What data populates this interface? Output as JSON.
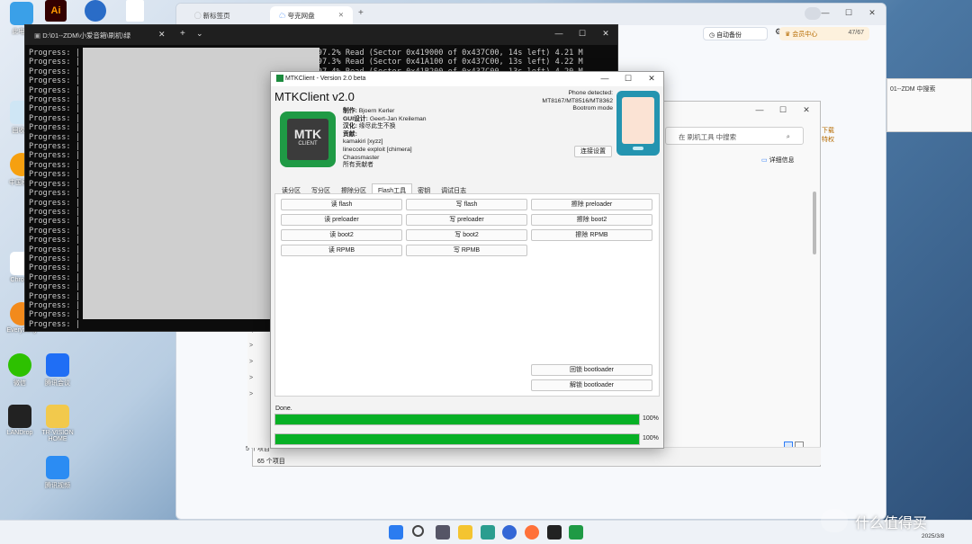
{
  "desktop": {
    "icons": [
      {
        "label": "此电脑"
      },
      {
        "label": "回收站"
      },
      {
        "label": "中国移动"
      },
      {
        "label": "Chrome"
      },
      {
        "label": "Everything"
      },
      {
        "label": "微信"
      },
      {
        "label": "腾讯会议"
      },
      {
        "label": "LANDrop"
      },
      {
        "label": "TR-VISION HOME"
      },
      {
        "label": "腾讯视频"
      }
    ]
  },
  "browser": {
    "tabs": [
      {
        "label": "新标签页"
      },
      {
        "label": "夸克网盘"
      }
    ],
    "new_tab": "+",
    "auto_backup": "自动备份",
    "vip_label": "会员中心",
    "storage": "47/67",
    "search_placeholder": "01--ZDM 中搜索",
    "download_label": "下载特权",
    "details_label": "详细信息"
  },
  "explorer": {
    "search_placeholder": "在 刷机工具 中搜索",
    "item_count": "5 个项目",
    "item_count_back": "65 个项目"
  },
  "terminal": {
    "title": "D:\\01--ZDM\\小爱音箱\\刷机\\绿",
    "lines": [
      "Progress: |                                                 | 97.2% Read (Sector 0x419000 of 0x437C00, 14s left) 4.21 M",
      "Progress: |                                                 | 97.3% Read (Sector 0x41A100 of 0x437C00, 13s left) 4.22 M",
      "Progress: |                                                 | 97.4% Read (Sector 0x41B200 of 0x437C00, 13s left) 4.20 M",
      "Progress: |",
      "Progress: |",
      "Progress: |",
      "Progress: |",
      "Progress: |",
      "Progress: |",
      "Progress: |",
      "Progress: |",
      "Progress: |",
      "Progress: |",
      "Progress: |",
      "Progress: |",
      "Progress: |",
      "Progress: |",
      "Progress: |",
      "Progress: |",
      "Progress: |",
      "Progress: |",
      "Progress: |",
      "Progress: |",
      "Progress: |",
      "Progress: |",
      "Progress: |",
      "Progress: |",
      "Progress: |",
      "Progress: |",
      "Progress: |"
    ]
  },
  "mtk": {
    "window_title": "MTKClient - Version 2.0 beta",
    "app_title": "MTKClient v2.0",
    "logo_line1": "MTK",
    "logo_line2": "CLIENT",
    "credits": [
      {
        "label": "制作:",
        "value": "Bjoern Kerler"
      },
      {
        "label": "GUI设计:",
        "value": "Geert-Jan Kreileman"
      },
      {
        "label": "汉化:",
        "value": "缘尽此生不换"
      },
      {
        "label": "贡献:",
        "value": ""
      }
    ],
    "contributors": [
      "kamakiri [xyzz]",
      "linecode exploit [chimera]",
      "Chaosmaster",
      "所有贡献者"
    ],
    "phone_detected": "Phone detected:",
    "phone_model": "MT8167/MT8516/MT8362",
    "phone_mode": "Bootrom mode",
    "connect_button": "连接设置",
    "tabs": [
      "读分区",
      "写分区",
      "擦除分区",
      "Flash工具",
      "密钥",
      "调试日志"
    ],
    "active_tab": "Flash工具",
    "buttons": {
      "read_flash": "读 flash",
      "write_flash": "写 flash",
      "erase_preloader": "擦除 preloader",
      "read_preloader": "读 preloader",
      "write_preloader": "写 preloader",
      "erase_boot2": "擦除 boot2",
      "read_boot2": "读 boot2",
      "write_boot2": "写 boot2",
      "erase_rpmb": "擦除 RPMB",
      "read_rpmb": "读 RPMB",
      "write_rpmb": "写 RPMB",
      "lock_bootloader": "回锁 bootloader",
      "unlock_bootloader": "解锁 bootloader"
    },
    "status": "Done.",
    "progress1": {
      "value": 100,
      "label": "100%"
    },
    "progress2": {
      "value": 100,
      "label": "100%"
    }
  },
  "taskbar": {
    "date": "2025/3/8"
  },
  "watermark": "什么值得买"
}
